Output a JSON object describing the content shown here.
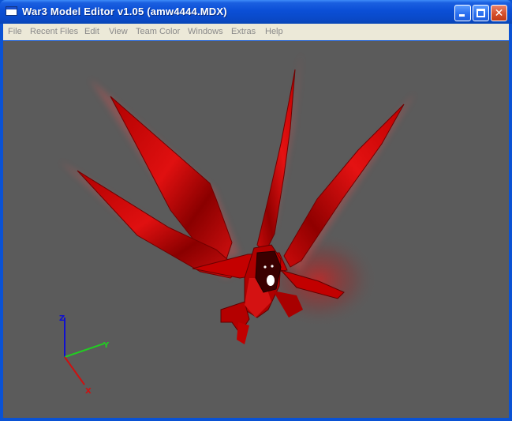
{
  "window": {
    "title": "War3 Model Editor v1.05 (amw4444.MDX)",
    "icon": "app-window-icon",
    "controls": {
      "minimize": "minimize-icon",
      "maximize": "maximize-icon",
      "close": "close-icon"
    }
  },
  "menu": {
    "items": [
      {
        "label": "File"
      },
      {
        "label": "Recent Files"
      },
      {
        "label": "Edit"
      },
      {
        "label": "View"
      },
      {
        "label": "Team Color"
      },
      {
        "label": "Windows"
      },
      {
        "label": "Extras"
      },
      {
        "label": "Help"
      }
    ]
  },
  "viewport": {
    "background": "#5b5b5b",
    "model_color": "#c80000",
    "axes": {
      "z": {
        "label": "Z",
        "color": "#1010d0"
      },
      "y": {
        "label": "Y",
        "color": "#22cc22"
      },
      "x": {
        "label": "X",
        "color": "#cc1111"
      }
    }
  }
}
